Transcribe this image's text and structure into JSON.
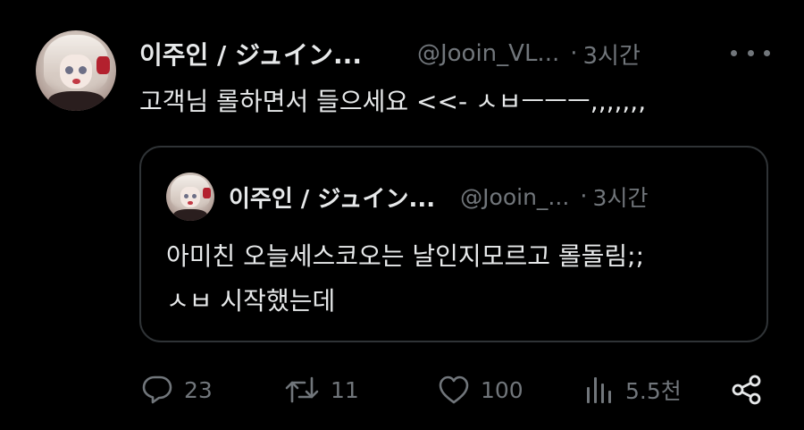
{
  "tweet": {
    "display_name": "이주인 / ジュイン...",
    "handle": "@Jooin_VL...",
    "separator": "·",
    "time": "3시간",
    "text": "고객님 롤하면서 들으세요 <<- ㅅㅂㅡㅡㅡ,,,,,,,"
  },
  "quote": {
    "display_name": "이주인 / ジュイン...",
    "handle": "@Jooin_...",
    "separator": "·",
    "time": "3시간",
    "text_lines": [
      "아미친 오늘세스코오는 날인지모르고 롤돌림;;",
      "ㅅㅂ 시작했는데"
    ]
  },
  "actions": {
    "replies": "23",
    "retweets": "11",
    "likes": "100",
    "views": "5.5천"
  },
  "icons": {
    "reply": "reply-icon",
    "retweet": "retweet-icon",
    "like": "heart-icon",
    "views": "bar-chart-icon",
    "share": "share-icon",
    "more": "more-dots-icon"
  },
  "colors": {
    "background": "#000000",
    "text_primary": "#e7e9ea",
    "text_secondary": "#71767b",
    "border": "#2f3336"
  }
}
